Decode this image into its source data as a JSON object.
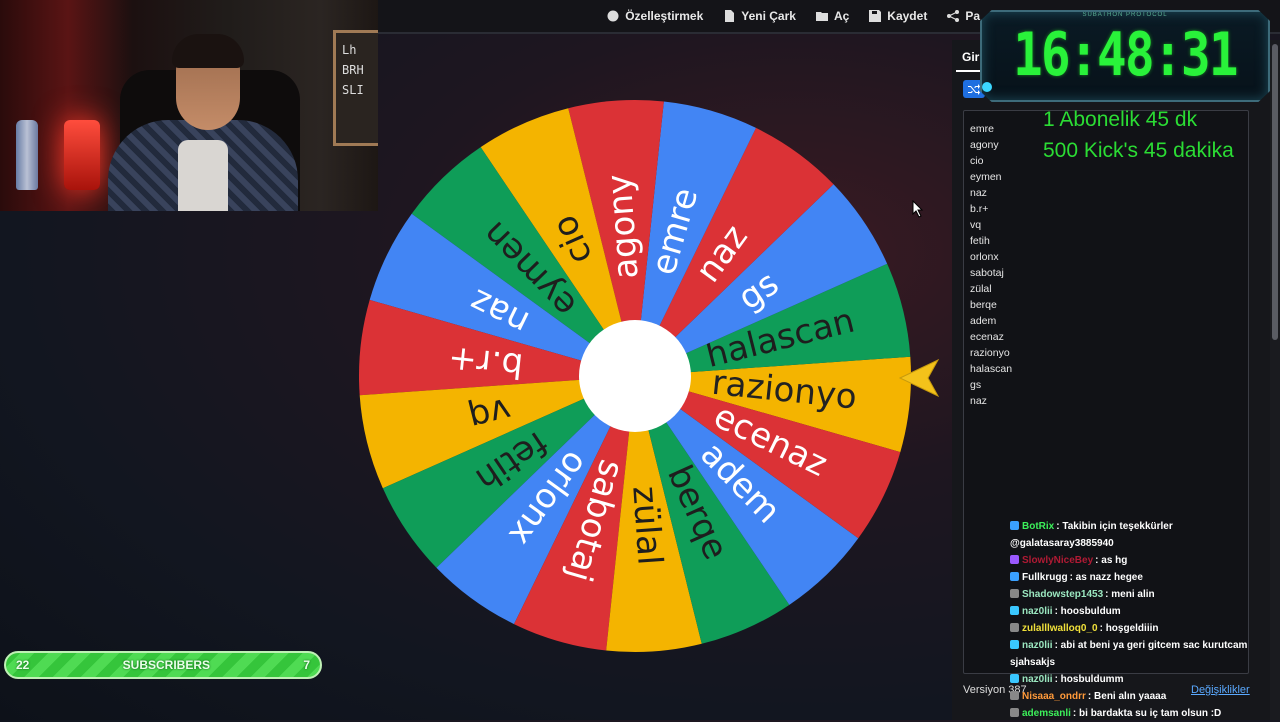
{
  "toolbar": {
    "items": [
      {
        "label": "Özelleştirmek",
        "icon": "palette-icon"
      },
      {
        "label": "Yeni Çark",
        "icon": "file-icon"
      },
      {
        "label": "Aç",
        "icon": "folder-icon"
      },
      {
        "label": "Kaydet",
        "icon": "save-icon"
      },
      {
        "label": "Pa",
        "icon": "share-icon"
      }
    ]
  },
  "panel": {
    "tab_label": "Gir",
    "entries": [
      "emre",
      "agony",
      "cio",
      "eymen",
      "naz",
      "b.r+",
      "vq",
      "fetih",
      "orlonx",
      "sabotaj",
      "zülal",
      "berqe",
      "adem",
      "ecenaz",
      "razionyo",
      "halascan",
      "gs",
      "naz"
    ],
    "version_label": "Versiyon 387",
    "changes_link": "Değişiklikler"
  },
  "wheel": {
    "slices": [
      "razionyo",
      "halascan",
      "gs",
      "naz",
      "emre",
      "agony",
      "cio",
      "eymen",
      "naz",
      "b.r+",
      "vq",
      "fetih",
      "orlonx",
      "sabotaj",
      "zülal",
      "berqe",
      "adem",
      "ecenaz"
    ],
    "colors": [
      "#f4b400",
      "#0f9d58",
      "#4285f4",
      "#db3236",
      "#4285f4",
      "#db3236",
      "#f4b400",
      "#0f9d58",
      "#4285f4",
      "#db3236",
      "#f4b400",
      "#0f9d58",
      "#4285f4",
      "#db3236",
      "#f4b400",
      "#0f9d58",
      "#4285f4",
      "#db3236"
    ]
  },
  "timer": {
    "header": "SUBATHON PROTOCOL",
    "time": "16:48:31"
  },
  "promo": {
    "line1": "1 Abonelik 45 dk",
    "line2": "500 Kick's 45 dakika"
  },
  "chat": [
    {
      "user": "BotRix",
      "text": ": Takibin için teşekkürler @galatasaray3885940",
      "color": "#3cf05a",
      "badge": "#3aa0ff"
    },
    {
      "user": "SlowlyNiceBey",
      "text": ": as hg",
      "color": "#b01a34",
      "badge": "#9b59ff"
    },
    {
      "user": "Fullkrugg",
      "text": ": as nazz hegee",
      "color": "#ffffff",
      "badge": "#3aa0ff"
    },
    {
      "user": "Shadowstep1453",
      "text": ": meni alin",
      "color": "#9be7c0",
      "badge": "#888888"
    },
    {
      "user": "naz0lii",
      "text": ": hoosbuldum",
      "color": "#9be7c0",
      "badge": "#3ac7ff"
    },
    {
      "user": "zulalllwalloq0_0",
      "text": ": hoşgeldiiin",
      "color": "#f0e03a",
      "badge": "#888888"
    },
    {
      "user": "naz0lii",
      "text": ": abi at beni ya geri gitcem sac kurutcam sjahsakjs",
      "color": "#9be7c0",
      "badge": "#3ac7ff"
    },
    {
      "user": "naz0lii",
      "text": ": hosbuldumm",
      "color": "#9be7c0",
      "badge": "#3ac7ff"
    },
    {
      "user": "Nisaaa_ondrr",
      "text": ": Beni alın yaaaa",
      "color": "#ff9a3a",
      "badge": "#888888"
    },
    {
      "user": "ademsanli",
      "text": ": bi bardakta su iç tam olsun :D",
      "color": "#3cf05a",
      "badge": "#888888"
    }
  ],
  "subscribers": {
    "left_count": "22",
    "label": "SUBSCRIBERS",
    "right_count": "7"
  }
}
